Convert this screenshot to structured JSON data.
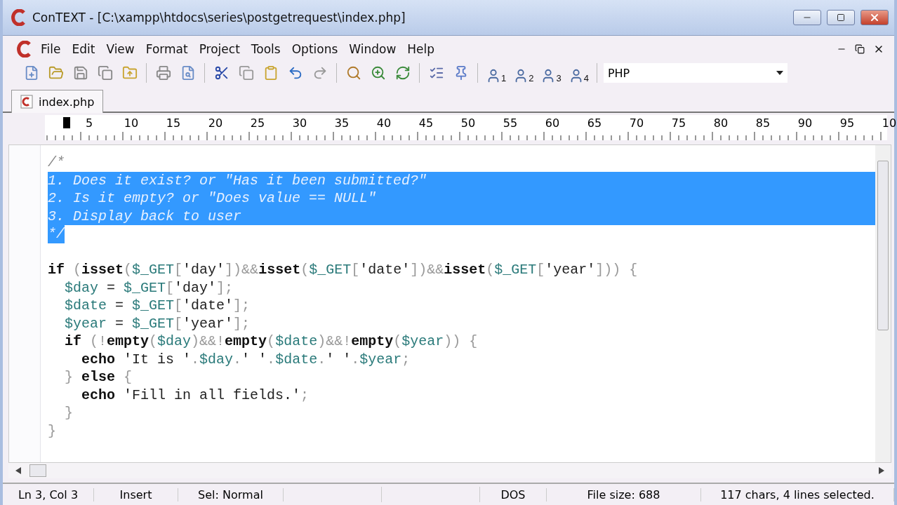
{
  "window": {
    "title": "ConTEXT - [C:\\xampp\\htdocs\\series\\postgetrequest\\index.php]"
  },
  "menu": [
    "File",
    "Edit",
    "View",
    "Format",
    "Project",
    "Tools",
    "Options",
    "Window",
    "Help"
  ],
  "user_tools": [
    "1",
    "2",
    "3",
    "4"
  ],
  "highlighter": {
    "value": "PHP"
  },
  "tabs": [
    {
      "label": "index.php",
      "selected": true
    }
  ],
  "ruler": [
    "5",
    "10",
    "15",
    "20",
    "25",
    "30",
    "35",
    "40",
    "45",
    "50",
    "55",
    "60",
    "65",
    "70",
    "75",
    "80",
    "85",
    "90",
    "95",
    "10"
  ],
  "comment_lines": [
    {
      "selected": false,
      "text": "/*"
    },
    {
      "selected": true,
      "text": "1. Does it exist? or \"Has it been submitted?\""
    },
    {
      "selected": true,
      "text": "2. Is it empty? or \"Does value == NULL\""
    },
    {
      "selected": true,
      "text": "3. Display back to user"
    },
    {
      "selected": true,
      "text": "*/"
    }
  ],
  "code": [
    {
      "tokens": [
        {
          "kind": "keyword",
          "text": "if"
        },
        {
          "kind": "punct",
          "text": " ("
        },
        {
          "kind": "keyword",
          "text": "isset"
        },
        {
          "kind": "punct",
          "text": "("
        },
        {
          "kind": "var",
          "text": "$_GET"
        },
        {
          "kind": "punct",
          "text": "["
        },
        {
          "kind": "string",
          "text": "'day'"
        },
        {
          "kind": "punct",
          "text": "])&&"
        },
        {
          "kind": "keyword",
          "text": "isset"
        },
        {
          "kind": "punct",
          "text": "("
        },
        {
          "kind": "var",
          "text": "$_GET"
        },
        {
          "kind": "punct",
          "text": "["
        },
        {
          "kind": "string",
          "text": "'date'"
        },
        {
          "kind": "punct",
          "text": "])&&"
        },
        {
          "kind": "keyword",
          "text": "isset"
        },
        {
          "kind": "punct",
          "text": "("
        },
        {
          "kind": "var",
          "text": "$_GET"
        },
        {
          "kind": "punct",
          "text": "["
        },
        {
          "kind": "string",
          "text": "'year'"
        },
        {
          "kind": "punct",
          "text": "])) {"
        }
      ],
      "children": [
        {
          "tokens": [
            {
              "kind": "var",
              "text": "$day"
            },
            {
              "kind": "plain",
              "text": " = "
            },
            {
              "kind": "var",
              "text": "$_GET"
            },
            {
              "kind": "punct",
              "text": "["
            },
            {
              "kind": "string",
              "text": "'day'"
            },
            {
              "kind": "punct",
              "text": "];"
            }
          ]
        },
        {
          "tokens": [
            {
              "kind": "var",
              "text": "$date"
            },
            {
              "kind": "plain",
              "text": " = "
            },
            {
              "kind": "var",
              "text": "$_GET"
            },
            {
              "kind": "punct",
              "text": "["
            },
            {
              "kind": "string",
              "text": "'date'"
            },
            {
              "kind": "punct",
              "text": "];"
            }
          ]
        },
        {
          "tokens": [
            {
              "kind": "var",
              "text": "$year"
            },
            {
              "kind": "plain",
              "text": " = "
            },
            {
              "kind": "var",
              "text": "$_GET"
            },
            {
              "kind": "punct",
              "text": "["
            },
            {
              "kind": "string",
              "text": "'year'"
            },
            {
              "kind": "punct",
              "text": "];"
            }
          ]
        },
        {
          "tokens": [
            {
              "kind": "keyword",
              "text": "if"
            },
            {
              "kind": "punct",
              "text": " (!"
            },
            {
              "kind": "keyword",
              "text": "empty"
            },
            {
              "kind": "punct",
              "text": "("
            },
            {
              "kind": "var",
              "text": "$day"
            },
            {
              "kind": "punct",
              "text": ")&&!"
            },
            {
              "kind": "keyword",
              "text": "empty"
            },
            {
              "kind": "punct",
              "text": "("
            },
            {
              "kind": "var",
              "text": "$date"
            },
            {
              "kind": "punct",
              "text": ")&&!"
            },
            {
              "kind": "keyword",
              "text": "empty"
            },
            {
              "kind": "punct",
              "text": "("
            },
            {
              "kind": "var",
              "text": "$year"
            },
            {
              "kind": "punct",
              "text": ")) {"
            }
          ],
          "children": [
            {
              "tokens": [
                {
                  "kind": "keyword",
                  "text": "echo"
                },
                {
                  "kind": "string",
                  "text": " 'It is '"
                },
                {
                  "kind": "punct",
                  "text": "."
                },
                {
                  "kind": "var",
                  "text": "$day"
                },
                {
                  "kind": "punct",
                  "text": "."
                },
                {
                  "kind": "string",
                  "text": "' '"
                },
                {
                  "kind": "punct",
                  "text": "."
                },
                {
                  "kind": "var",
                  "text": "$date"
                },
                {
                  "kind": "punct",
                  "text": "."
                },
                {
                  "kind": "string",
                  "text": "' '"
                },
                {
                  "kind": "punct",
                  "text": "."
                },
                {
                  "kind": "var",
                  "text": "$year"
                },
                {
                  "kind": "punct",
                  "text": ";"
                }
              ]
            }
          ]
        },
        {
          "tokens": [
            {
              "kind": "punct",
              "text": "} "
            },
            {
              "kind": "keyword",
              "text": "else"
            },
            {
              "kind": "punct",
              "text": " {"
            }
          ],
          "children": [
            {
              "tokens": [
                {
                  "kind": "keyword",
                  "text": "echo"
                },
                {
                  "kind": "string",
                  "text": " 'Fill in all fields.'"
                },
                {
                  "kind": "punct",
                  "text": ";"
                }
              ]
            }
          ]
        },
        {
          "tokens": [
            {
              "kind": "punct",
              "text": "}"
            }
          ]
        }
      ]
    },
    {
      "tokens": [
        {
          "kind": "punct",
          "text": "}"
        }
      ]
    }
  ],
  "status_bar": [
    "Ln 3, Col 3",
    "Insert",
    "Sel: Normal",
    "DOS",
    "File size: 688",
    "117 chars, 4 lines selected."
  ]
}
